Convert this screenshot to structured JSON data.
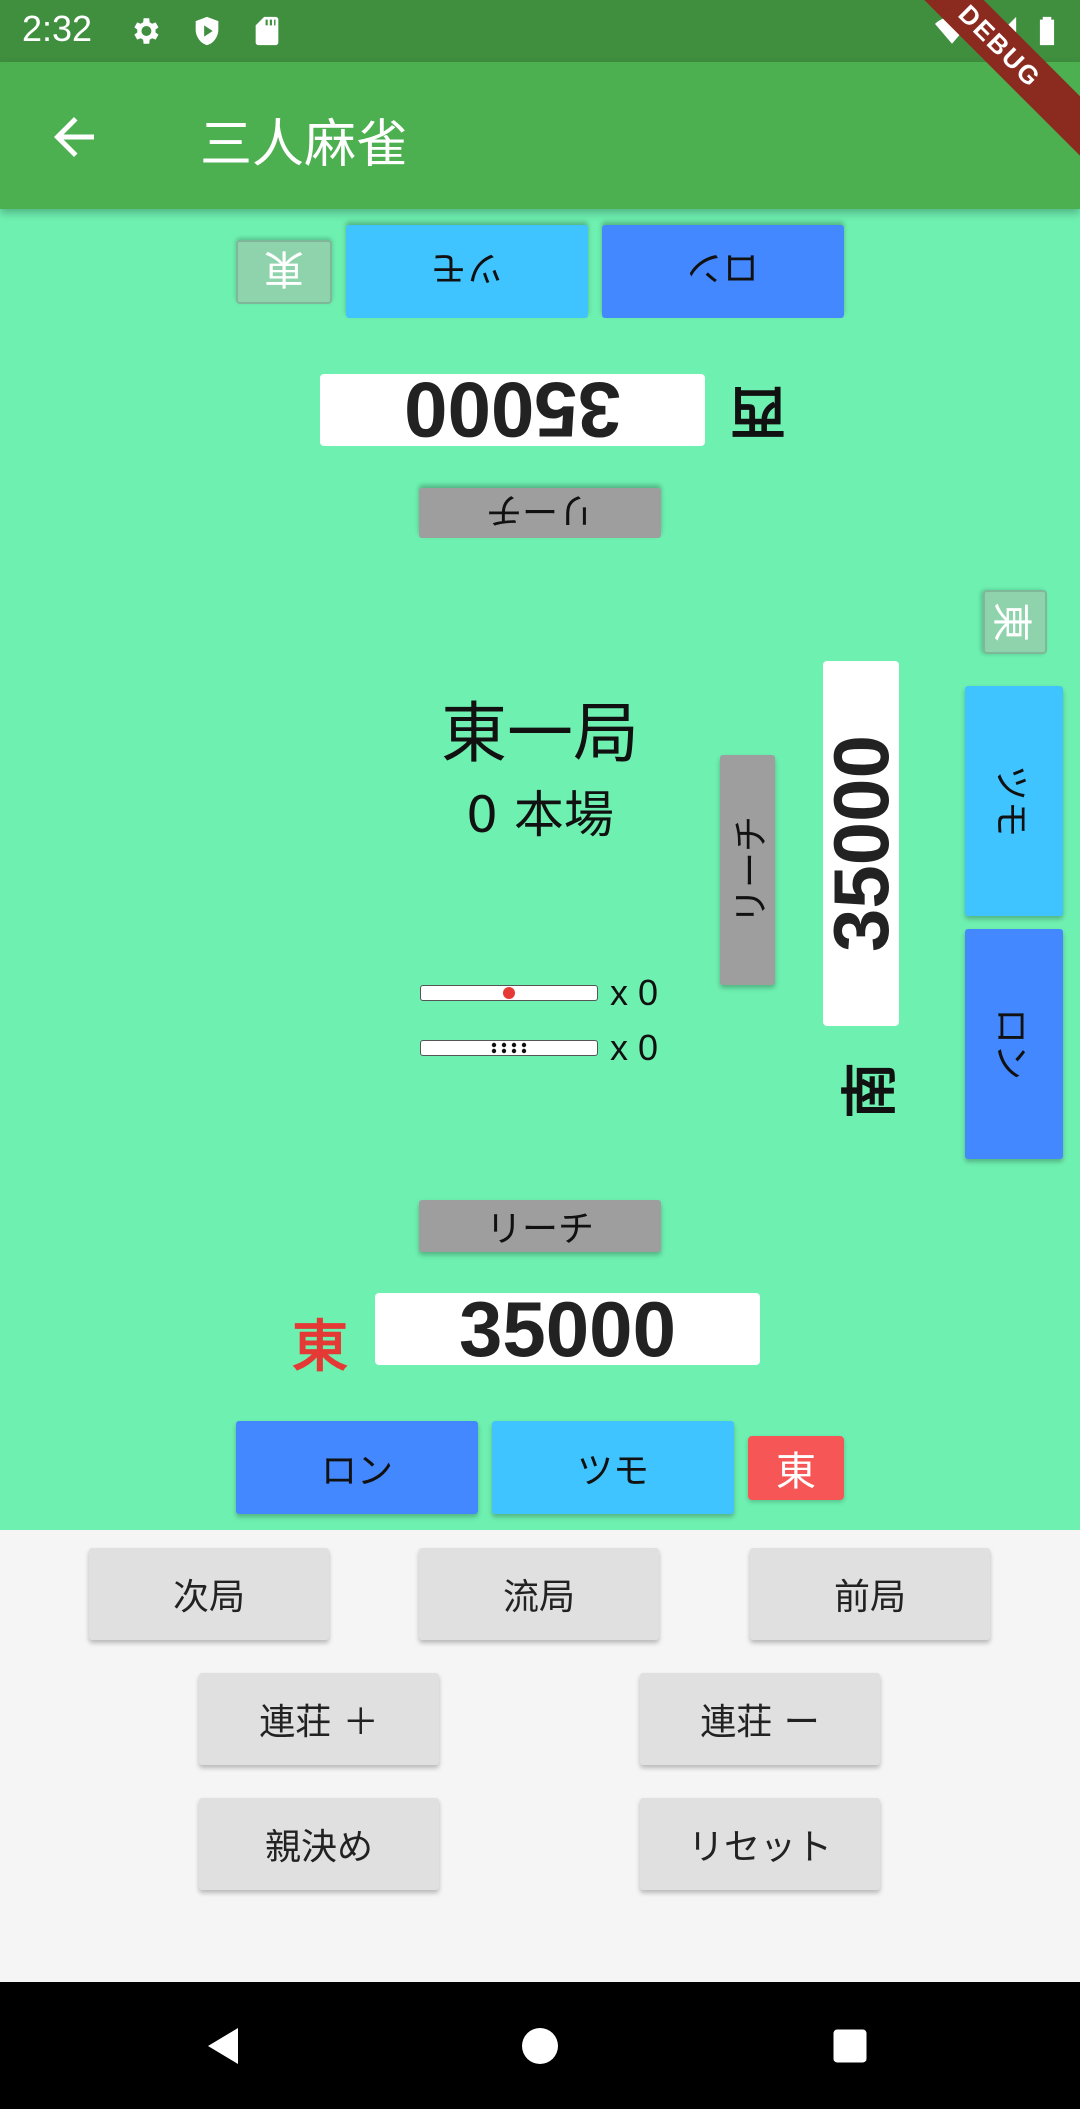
{
  "status_bar": {
    "time": "2:32",
    "icons": [
      "gear-icon",
      "play-protect-icon",
      "sd-card-icon",
      "wifi-icon",
      "signal-icon",
      "battery-icon"
    ]
  },
  "app_bar": {
    "title": "三人麻雀",
    "back_icon": "arrow-left-icon"
  },
  "debug_banner": "DEBUG",
  "colors": {
    "app_bar": "#4caf50",
    "status_bar": "#3f8f3f",
    "table": "#6ef0b0",
    "ron": "#4488ff",
    "tsumo": "#40c4ff",
    "riichi": "#9e9e9e",
    "dealer": "#f75656"
  },
  "players": {
    "bottom": {
      "seat_wind": "東",
      "score": "35000",
      "dealer_chip": "東",
      "ron": "ロン",
      "tsumo": "ツモ",
      "riichi": "リーチ"
    },
    "top": {
      "seat_wind": "西",
      "score": "35000",
      "wind_chip": "東",
      "ron": "ロン",
      "tsumo": "ツモ",
      "riichi": "リーチ"
    },
    "right": {
      "seat_wind": "南",
      "score": "35000",
      "wind_chip": "東",
      "ron": "ロン",
      "tsumo": "ツモ",
      "riichi": "リーチ"
    }
  },
  "round": {
    "name": "東一局",
    "honba": "0 本場"
  },
  "sticks": {
    "riichi_count": "x 0",
    "honba_count": "x 0"
  },
  "controls": {
    "next_round": "次局",
    "draw": "流局",
    "prev_round": "前局",
    "renchan_plus": "連荘 ＋",
    "renchan_minus": "連荘 ー",
    "decide_dealer": "親決め",
    "reset": "リセット"
  }
}
